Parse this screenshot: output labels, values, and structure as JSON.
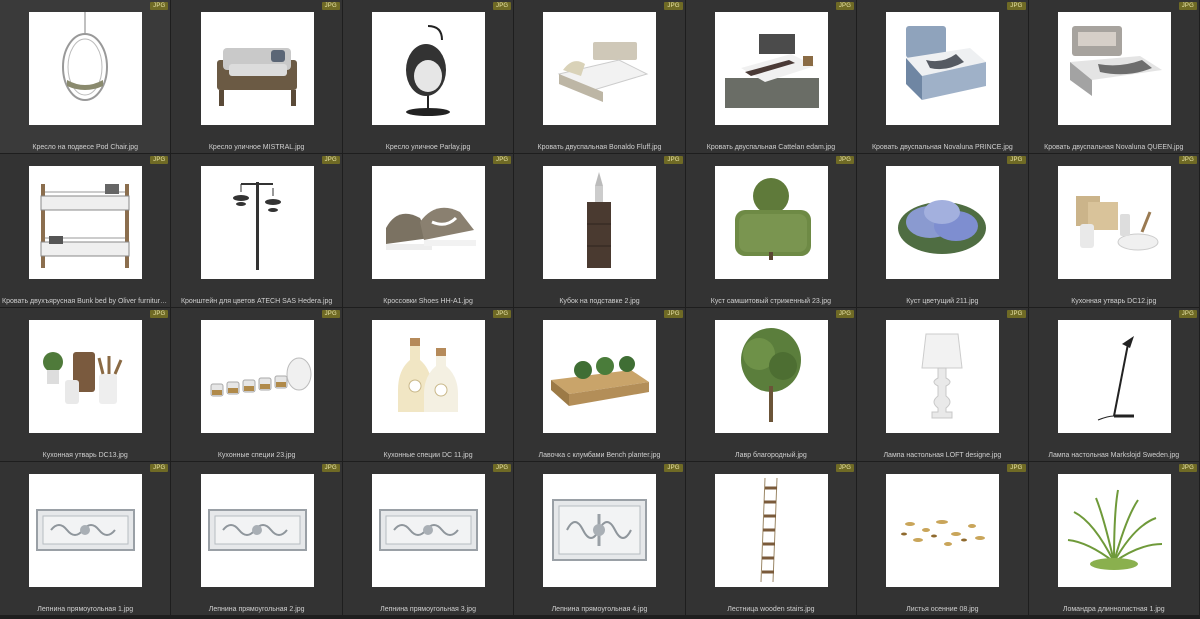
{
  "badge_text": "JPG",
  "files": [
    {
      "name": "Кресло на подвесе Pod Chair.jpg",
      "icon": "hanging-pod-chair"
    },
    {
      "name": "Кресло уличное MISTRAL.jpg",
      "icon": "outdoor-armchair"
    },
    {
      "name": "Кресло уличное Parlay.jpg",
      "icon": "hanging-egg-chair"
    },
    {
      "name": "Кровать двуспальная Bonaldo Fluff.jpg",
      "icon": "double-bed"
    },
    {
      "name": "Кровать двуспальная Cattelan edam.jpg",
      "icon": "double-bed-dark"
    },
    {
      "name": "Кровать двуспальная Novaluna PRINCE.jpg",
      "icon": "double-bed-blue"
    },
    {
      "name": "Кровать двуспальная Novaluna QUEEN.jpg",
      "icon": "double-bed-gray"
    },
    {
      "name": "Кровать двухъярусная Bunk bed by Oliver furniture.jpg",
      "icon": "bunk-bed"
    },
    {
      "name": "Кронштейн для цветов ATECH SAS Hedera.jpg",
      "icon": "flower-bracket"
    },
    {
      "name": "Кроссовки Shoes HH-A1.jpg",
      "icon": "sneakers"
    },
    {
      "name": "Кубок на подставке 2.jpg",
      "icon": "trophy-stand"
    },
    {
      "name": "Куст самшитовый стриженный 23.jpg",
      "icon": "boxwood-bush"
    },
    {
      "name": "Куст цветущий 211.jpg",
      "icon": "flowering-bush"
    },
    {
      "name": "Кухонная утварь DC12.jpg",
      "icon": "kitchenware"
    },
    {
      "name": "Кухонная утварь DC13.jpg",
      "icon": "kitchenware-plant"
    },
    {
      "name": "Кухонные специи 23.jpg",
      "icon": "spice-jars"
    },
    {
      "name": "Кухонные специи DC 11.jpg",
      "icon": "spice-bottles"
    },
    {
      "name": "Лавочка с клумбами Bench planter.jpg",
      "icon": "bench-planter"
    },
    {
      "name": "Лавр благородный.jpg",
      "icon": "laurel-tree"
    },
    {
      "name": "Лампа настольная LOFT designe.jpg",
      "icon": "table-lamp"
    },
    {
      "name": "Лампа настольная Markslojd Sweden.jpg",
      "icon": "desk-lamp"
    },
    {
      "name": "Лепнина прямоугольная 1.jpg",
      "icon": "molding-panel"
    },
    {
      "name": "Лепнина прямоугольная 2.jpg",
      "icon": "molding-panel"
    },
    {
      "name": "Лепнина прямоугольная 3.jpg",
      "icon": "molding-panel"
    },
    {
      "name": "Лепнина прямоугольная 4.jpg",
      "icon": "molding-panel-large"
    },
    {
      "name": "Лестница wooden stairs.jpg",
      "icon": "rope-ladder"
    },
    {
      "name": "Листья осенние 08.jpg",
      "icon": "autumn-leaves"
    },
    {
      "name": "Ломандра длиннолистная 1.jpg",
      "icon": "grass-tuft"
    }
  ]
}
